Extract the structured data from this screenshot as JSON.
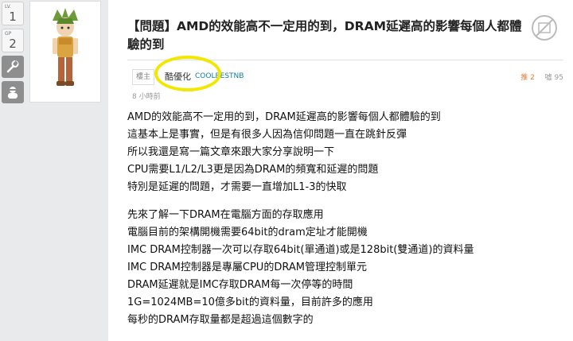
{
  "sidebar": {
    "level": {
      "label": "LV.",
      "value": "1"
    },
    "gp": {
      "label": "GP",
      "value": "2"
    },
    "tools": [
      {
        "icon": "wrench-icon"
      },
      {
        "icon": "avatar-icon"
      }
    ]
  },
  "post": {
    "title": "【問題】AMD的效能高不一定用的到，DRAM延遲高的影響每個人都體驗的到",
    "floor_label": "樓主",
    "author_nick": "酷優化",
    "author_id": "COOLBESTNB",
    "time": "8 小時前",
    "push_count": "推 2",
    "reply_count": "噓 95",
    "paragraphs": [
      [
        "AMD的效能高不一定用的到，DRAM延遲高的影響每個人都體驗的到",
        "這基本上是事實，但是有很多人因為信仰問題一直在跳針反彈",
        "所以我還是寫一篇文章來跟大家分享說明一下",
        "CPU需要L1/L2/L3更是因為DRAM的頻寬和延遲的問題",
        "特別是延遲的問題，才需要一直增加L1-3的快取"
      ],
      [
        "先來了解一下DRAM在電腦方面的存取應用",
        "電腦目前的架構開機需要64bit的dram定址才能開機",
        "IMC DRAM控制器一次可以存取64bit(單通道)或是128bit(雙通道)的資料量",
        "IMC DRAM控制器是專屬CPU的DRAM管理控制單元",
        "DRAM延遲就是IMC存取DRAM每一次停等的時間",
        "1G=1024MB=10億多bit的資料量，目前許多的應用",
        "每秒的DRAM存取量都是超過這個數字的"
      ]
    ]
  },
  "colors": {
    "highlight": "#f2e700",
    "link": "#127ca0",
    "push": "#e07b39"
  }
}
